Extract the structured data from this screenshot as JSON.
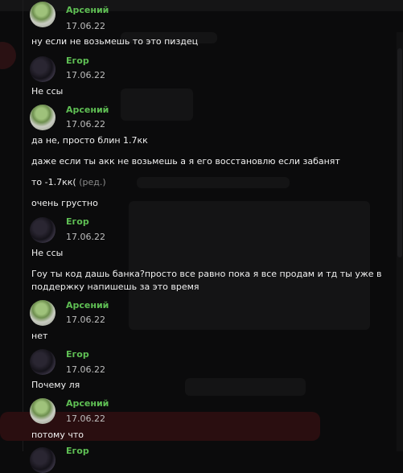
{
  "messages": [
    {
      "author": "Арсений",
      "date": "17.06.22",
      "lines": [
        "ну если не возьмешь то это пиздец"
      ]
    },
    {
      "author": "Егор",
      "date": "17.06.22",
      "lines": [
        "Не ссы"
      ]
    },
    {
      "author": "Арсений",
      "date": "17.06.22",
      "lines": [
        "да не, просто блин 1.7кк",
        "даже если ты акк не возьмешь а я его восстановлю если забанят",
        "то -1.7кк(",
        "очень грустно"
      ],
      "edited_label": "(ред.)"
    },
    {
      "author": "Егор",
      "date": "17.06.22",
      "lines": [
        "Не ссы",
        "Гоу ты код дашь банка?просто все равно пока я все продам и тд ты уже в поддержку напишешь за это время"
      ]
    },
    {
      "author": "Арсений",
      "date": "17.06.22",
      "lines": [
        "нет"
      ]
    },
    {
      "author": "Егор",
      "date": "17.06.22",
      "lines": [
        "Почему ля"
      ]
    },
    {
      "author": "Арсений",
      "date": "17.06.22",
      "lines": [
        "потому что"
      ]
    },
    {
      "author": "Егор"
    }
  ],
  "colors": {
    "arseniy_name": "#5fbf54",
    "egor_name": "#5fbf54",
    "background": "#0b0b0c"
  }
}
